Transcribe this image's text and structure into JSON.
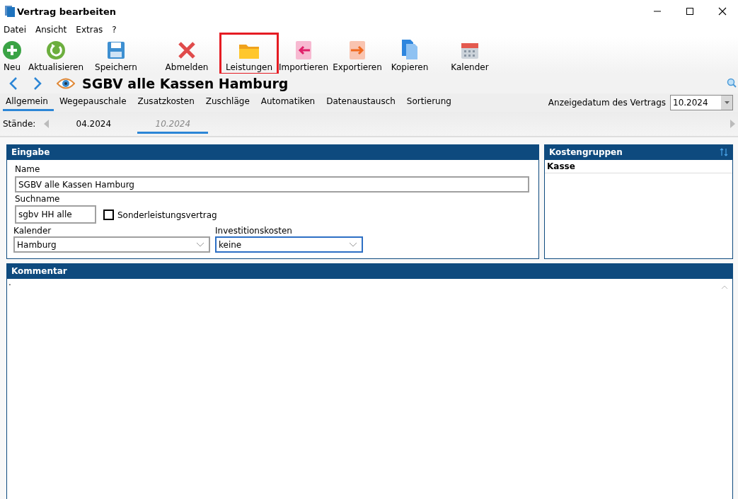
{
  "window": {
    "title": "Vertrag bearbeiten"
  },
  "menu": [
    "Datei",
    "Ansicht",
    "Extras",
    "?"
  ],
  "toolbar": [
    {
      "kind": "add",
      "label": "Neu",
      "highlighted": false
    },
    {
      "kind": "refresh",
      "label": "Aktualisieren",
      "highlighted": false
    },
    {
      "kind": "save",
      "label": "Speichern",
      "highlighted": false
    },
    {
      "kind": "cancel",
      "label": "Abmelden",
      "highlighted": false
    },
    {
      "kind": "folder",
      "label": "Leistungen",
      "highlighted": true
    },
    {
      "kind": "import",
      "label": "Importieren",
      "highlighted": false
    },
    {
      "kind": "export",
      "label": "Exportieren",
      "highlighted": false
    },
    {
      "kind": "copy",
      "label": "Kopieren",
      "highlighted": false
    },
    {
      "kind": "calendar",
      "label": "Kalender",
      "highlighted": false
    }
  ],
  "record_title": "SGBV alle Kassen Hamburg",
  "tabs": [
    {
      "label": "Allgemein",
      "selected": true
    },
    {
      "label": "Wegepauschale",
      "selected": false
    },
    {
      "label": "Zusatzkosten",
      "selected": false
    },
    {
      "label": "Zuschläge",
      "selected": false
    },
    {
      "label": "Automatiken",
      "selected": false
    },
    {
      "label": "Datenaustausch",
      "selected": false
    },
    {
      "label": "Sortierung",
      "selected": false
    }
  ],
  "display_date": {
    "label": "Anzeigedatum des Vertrags",
    "value": "10.2024"
  },
  "versions": {
    "label": "Stände:",
    "items": [
      {
        "label": "04.2024",
        "selected": false
      },
      {
        "label": "10.2024",
        "selected": true
      }
    ]
  },
  "input_panel": {
    "title": "Eingabe",
    "name": {
      "label": "Name",
      "value": "SGBV alle Kassen Hamburg"
    },
    "search_name": {
      "label": "Suchname",
      "value": "sgbv HH alle"
    },
    "special_contract": {
      "label": "Sonderleistungsvertrag",
      "checked": false
    },
    "calendar": {
      "label": "Kalender",
      "value": "Hamburg",
      "focused": false
    },
    "investment_costs": {
      "label": "Investitionskosten",
      "value": "keine",
      "focused": true
    }
  },
  "cost_groups": {
    "title": "Kostengruppen",
    "column": "Kasse"
  },
  "comment": {
    "title": "Kommentar",
    "value": "."
  }
}
